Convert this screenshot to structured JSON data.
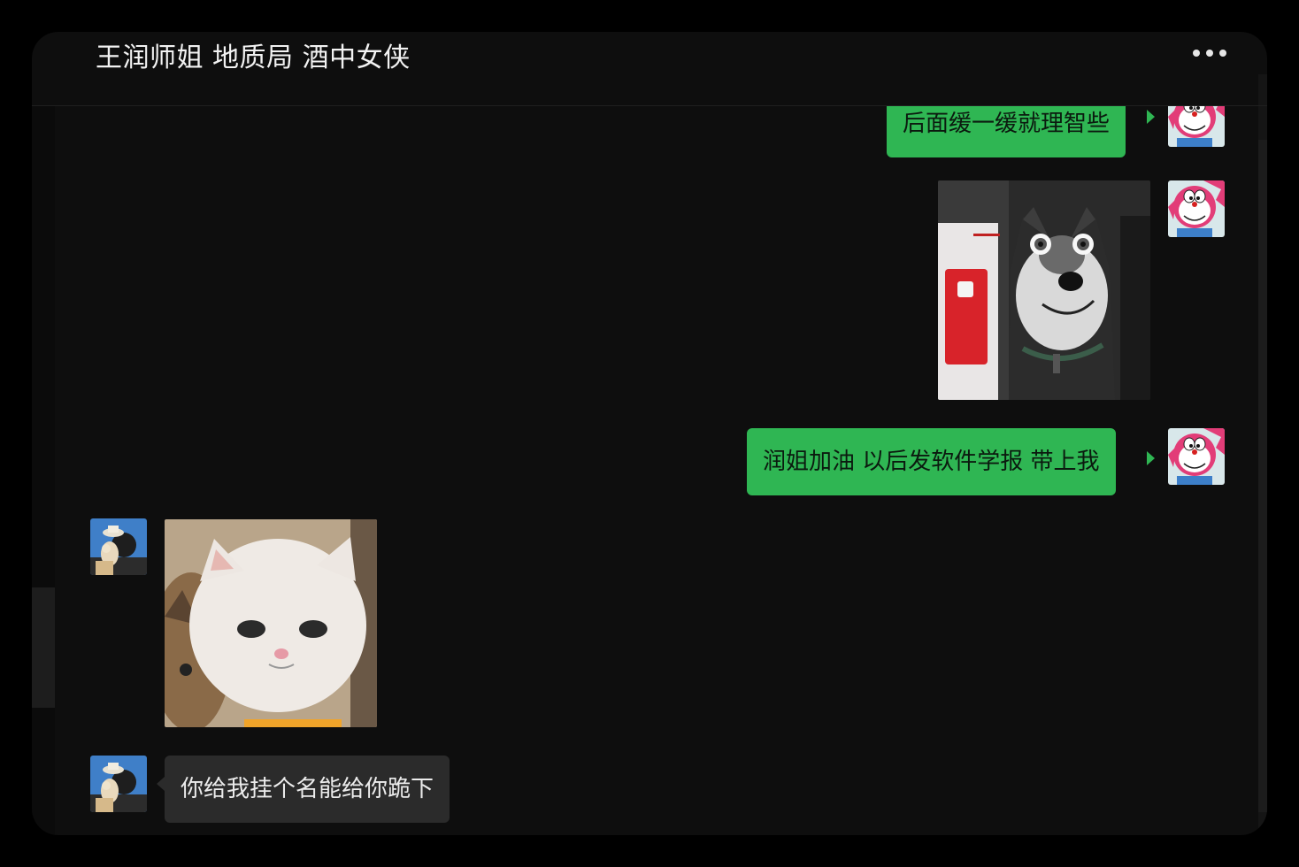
{
  "chat": {
    "title": "王润师姐 地质局 酒中女侠",
    "more_icon": "more-dots-icon"
  },
  "messages": [
    {
      "from": "me",
      "type": "text",
      "text": "后面缓一缓就理智些"
    },
    {
      "from": "me",
      "type": "sticker",
      "sticker": "husky-dog-sticker"
    },
    {
      "from": "me",
      "type": "text",
      "text": "润姐加油 以后发软件学报 带上我"
    },
    {
      "from": "other",
      "type": "sticker",
      "sticker": "white-cat-sticker"
    },
    {
      "from": "other",
      "type": "text",
      "text": "你给我挂个名能给你跪下"
    }
  ],
  "colors": {
    "background": "#0e0e0e",
    "my_bubble": "#2fb653",
    "other_bubble": "#2b2b2b",
    "title_text": "#f2f2f2"
  }
}
